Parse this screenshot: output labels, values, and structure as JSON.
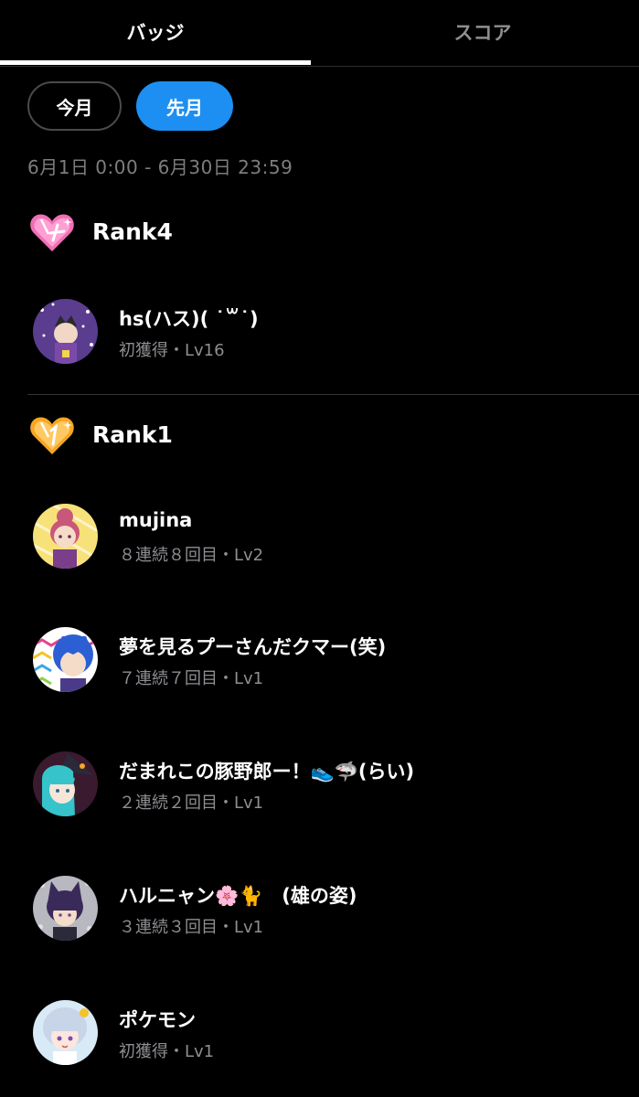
{
  "tabs": {
    "badges_label": "バッジ",
    "score_label": "スコア",
    "active": "badges"
  },
  "period_toggle": {
    "this_month_label": "今月",
    "last_month_label": "先月",
    "selected": "last_month"
  },
  "period_range": "6月1日 0:00 - 6月30日 23:59",
  "colors": {
    "accent": "#1d8ff2",
    "background": "#000000",
    "rank4_icon": "#f06fb4",
    "rank1_icon": "#f5a623",
    "secondary_text": "#8e8e93"
  },
  "ranks": [
    {
      "title": "Rank4",
      "icon": "pink-heart-4-icon",
      "users": [
        {
          "name": "hs(ハス)( ˙꒳˙)",
          "meta": "初獲得・Lv16",
          "avatar": "purple-character-avatar"
        }
      ]
    },
    {
      "title": "Rank1",
      "icon": "orange-heart-1-icon",
      "users": [
        {
          "name": "mujina",
          "meta": "８連続８回目・Lv2",
          "avatar": "pink-hair-character-avatar"
        },
        {
          "name": "夢を見るプーさんだクマー(笑)",
          "meta": "７連続７回目・Lv1",
          "avatar": "blue-hair-character-avatar"
        },
        {
          "name": "だまれこの豚野郎ー！👟🦈(らい)",
          "meta": "２連続２回目・Lv1",
          "avatar": "teal-hair-witch-avatar"
        },
        {
          "name": "ハルニャン🌸🐈　(雄の姿)",
          "meta": "３連続３回目・Lv1",
          "avatar": "cat-ears-character-avatar"
        },
        {
          "name": "ポケモン",
          "meta": "初獲得・Lv1",
          "avatar": "silver-hair-character-avatar"
        }
      ]
    }
  ]
}
